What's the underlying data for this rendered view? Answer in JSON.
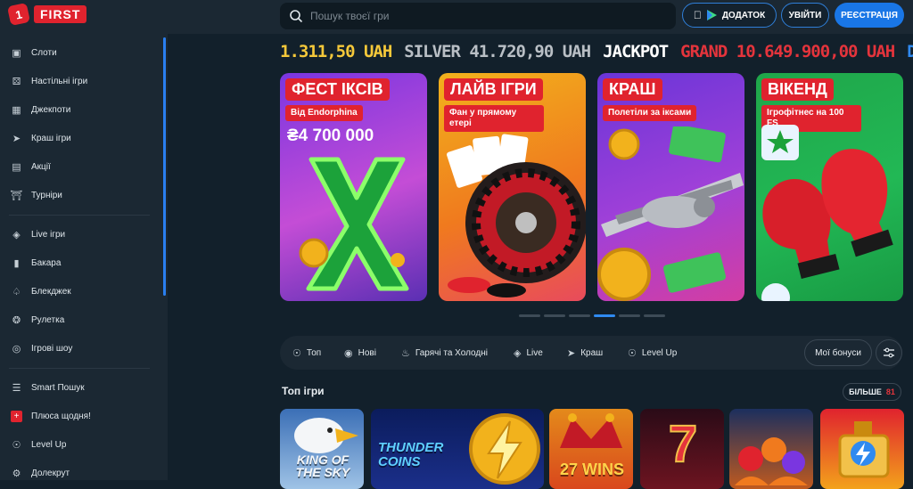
{
  "brand": {
    "logo_mark": "1",
    "logo_text": "FIRST",
    "accent": "#e0232e",
    "primary": "#1976e6"
  },
  "header": {
    "search_placeholder": "Пошук твоєї гри",
    "app_label": "ДОДАТОК",
    "login_label": "УВІЙТИ",
    "register_label": "РЕЄСТРАЦІЯ"
  },
  "sidebar": {
    "items": [
      {
        "label": "Слоти",
        "icon": "slots-icon"
      },
      {
        "label": "Настільні ігри",
        "icon": "dice-icon"
      },
      {
        "label": "Джекпоти",
        "icon": "jackpot-icon"
      },
      {
        "label": "Краш ігри",
        "icon": "crash-icon"
      },
      {
        "label": "Акції",
        "icon": "gift-icon"
      },
      {
        "label": "Турніри",
        "icon": "trophy-icon"
      },
      {
        "label": "Live ігри",
        "icon": "live-icon"
      },
      {
        "label": "Бакара",
        "icon": "baccarat-icon"
      },
      {
        "label": "Блекджек",
        "icon": "spade-icon"
      },
      {
        "label": "Рулетка",
        "icon": "roulette-icon"
      },
      {
        "label": "Ігрові шоу",
        "icon": "show-icon"
      },
      {
        "label": "Smart Пошук",
        "icon": "filter-icon"
      },
      {
        "label": "Плюса щодня!",
        "icon": "plus-icon"
      },
      {
        "label": "Level Up",
        "icon": "levelup-icon"
      },
      {
        "label": "Долекрут",
        "icon": "wheel-icon"
      }
    ]
  },
  "jackpot_ticker": {
    "items": [
      "1.311,50 UAH",
      "SILVER 41.720,90 UAH",
      "JACKPOT",
      "GRAND 10.649.900,00 UAH",
      "DI"
    ]
  },
  "banners": [
    {
      "title": "ФЕСТ ІКСІВ",
      "subtitle": "Від Endorphina",
      "amount": "₴4 700 000"
    },
    {
      "title": "ЛАЙВ ІГРИ",
      "subtitle": "Фан у прямому етері",
      "amount": ""
    },
    {
      "title": "КРАШ",
      "subtitle": "Полетіли за іксами",
      "amount": ""
    },
    {
      "title": "ВІКЕНД",
      "subtitle": "Ігрофітнес на 100 FS",
      "amount": ""
    }
  ],
  "carousel": {
    "count": 6,
    "active_index": 3
  },
  "filters": {
    "items": [
      {
        "label": "Топ",
        "icon": "top-icon"
      },
      {
        "label": "Нові",
        "icon": "new-icon"
      },
      {
        "label": "Гарячі та Холодні",
        "icon": "fire-icon"
      },
      {
        "label": "Live",
        "icon": "live-icon"
      },
      {
        "label": "Краш",
        "icon": "crash-icon"
      },
      {
        "label": "Level Up",
        "icon": "levelup-icon"
      }
    ],
    "bonus_label": "Мої бонуси"
  },
  "top_games": {
    "title": "Топ ігри",
    "more_label": "БІЛЬШЕ",
    "more_count": "81",
    "tiles": [
      {
        "text": "KING OF THE SKY"
      },
      {
        "text": "THUNDER COINS"
      },
      {
        "text": "27 WINS"
      },
      {
        "text": "7"
      },
      {
        "text": ""
      },
      {
        "text": ""
      }
    ]
  }
}
